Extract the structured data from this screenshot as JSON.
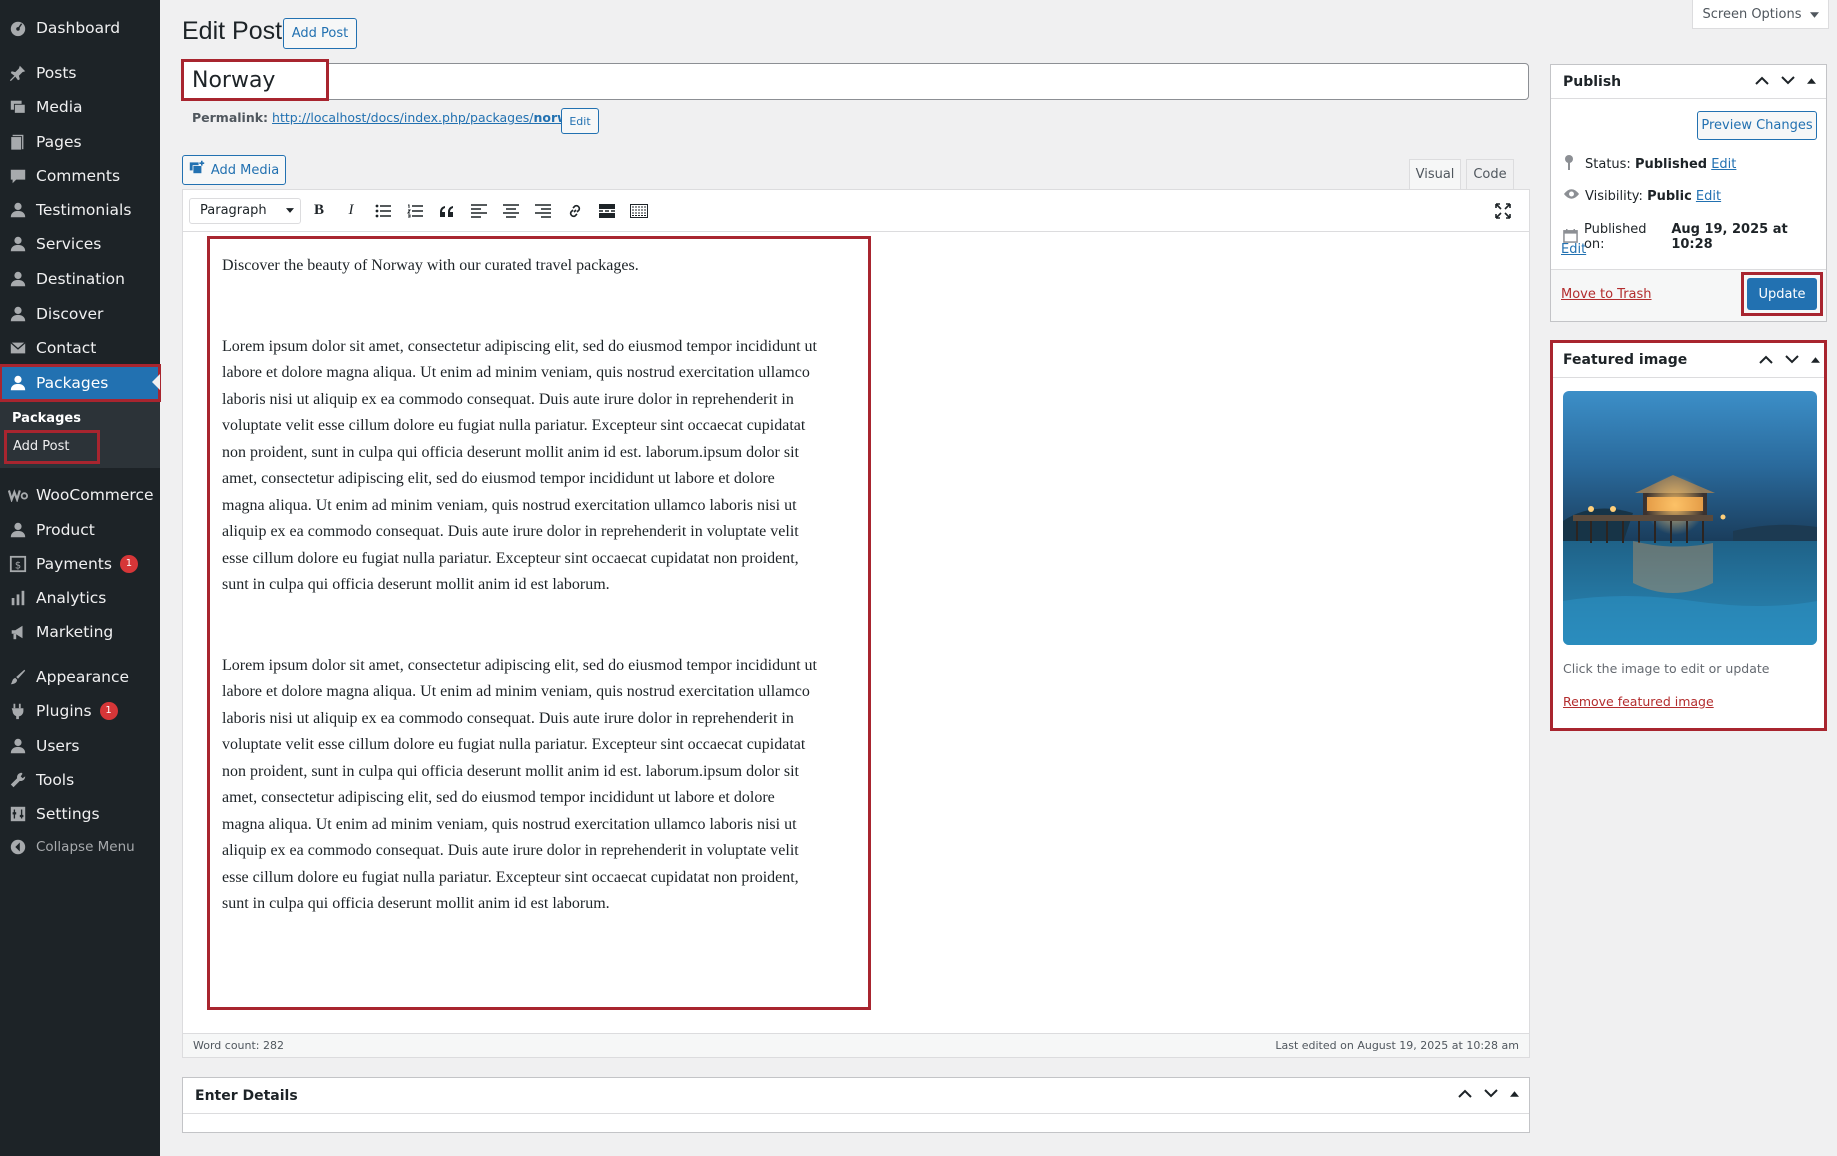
{
  "sidebar": {
    "items": [
      {
        "key": "dashboard",
        "label": "Dashboard",
        "icon": "dashboard-icon"
      },
      {
        "key": "posts",
        "label": "Posts",
        "icon": "pin-icon"
      },
      {
        "key": "media",
        "label": "Media",
        "icon": "media-icon"
      },
      {
        "key": "pages",
        "label": "Pages",
        "icon": "page-icon"
      },
      {
        "key": "comments",
        "label": "Comments",
        "icon": "comment-icon"
      },
      {
        "key": "testimonials",
        "label": "Testimonials",
        "icon": "user-icon"
      },
      {
        "key": "services",
        "label": "Services",
        "icon": "user-icon"
      },
      {
        "key": "destination",
        "label": "Destination",
        "icon": "user-icon"
      },
      {
        "key": "discover",
        "label": "Discover",
        "icon": "user-icon"
      },
      {
        "key": "contact",
        "label": "Contact",
        "icon": "mail-icon"
      },
      {
        "key": "packages",
        "label": "Packages",
        "icon": "user-icon"
      },
      {
        "key": "woocommerce",
        "label": "WooCommerce",
        "icon": "woo-icon"
      },
      {
        "key": "product",
        "label": "Product",
        "icon": "user-icon"
      },
      {
        "key": "payments",
        "label": "Payments",
        "icon": "dollar-icon",
        "badge": "1"
      },
      {
        "key": "analytics",
        "label": "Analytics",
        "icon": "chart-icon"
      },
      {
        "key": "marketing",
        "label": "Marketing",
        "icon": "megaphone-icon"
      },
      {
        "key": "appearance",
        "label": "Appearance",
        "icon": "brush-icon"
      },
      {
        "key": "plugins",
        "label": "Plugins",
        "icon": "plugin-icon",
        "badge": "1"
      },
      {
        "key": "users",
        "label": "Users",
        "icon": "user-icon"
      },
      {
        "key": "tools",
        "label": "Tools",
        "icon": "wrench-icon"
      },
      {
        "key": "settings",
        "label": "Settings",
        "icon": "settings-icon"
      }
    ],
    "submenu_title": "Packages",
    "submenu_item": "Add Post",
    "collapse_label": "Collapse Menu"
  },
  "header": {
    "title": "Edit Post",
    "add_post_button": "Add Post",
    "screen_options": "Screen Options"
  },
  "post": {
    "title": "Norway",
    "permalink_label": "Permalink:",
    "permalink_base": "http://localhost/docs/index.php/packages/",
    "permalink_slug": "norway",
    "permalink_end": "/",
    "permalink_edit": "Edit"
  },
  "editor": {
    "add_media": "Add Media",
    "tab_visual": "Visual",
    "tab_code": "Code",
    "format_select": "Paragraph",
    "paragraphs": [
      "Discover the beauty of Norway with our curated travel packages.",
      "Lorem ipsum dolor sit amet, consectetur adipiscing elit, sed do eiusmod tempor incididunt ut labore et dolore magna aliqua. Ut enim ad minim veniam, quis nostrud exercitation ullamco laboris nisi ut aliquip ex ea commodo consequat. Duis aute irure dolor in reprehenderit in voluptate velit esse cillum dolore eu fugiat nulla pariatur. Excepteur sint occaecat cupidatat non proident, sunt in culpa qui officia deserunt mollit anim id est. laborum.ipsum dolor sit amet, consectetur adipiscing elit, sed do eiusmod tempor incididunt ut labore et dolore magna aliqua. Ut enim ad minim veniam, quis nostrud exercitation ullamco laboris nisi ut aliquip ex ea commodo consequat. Duis aute irure dolor in reprehenderit in voluptate velit esse cillum dolore eu fugiat nulla pariatur. Excepteur sint occaecat cupidatat non proident, sunt in culpa qui officia deserunt mollit anim id est laborum.",
      "Lorem ipsum dolor sit amet, consectetur adipiscing elit, sed do eiusmod tempor incididunt ut labore et dolore magna aliqua. Ut enim ad minim veniam, quis nostrud exercitation ullamco laboris nisi ut aliquip ex ea commodo consequat. Duis aute irure dolor in reprehenderit in voluptate velit esse cillum dolore eu fugiat nulla pariatur. Excepteur sint occaecat cupidatat non proident, sunt in culpa qui officia deserunt mollit anim id est. laborum.ipsum dolor sit amet, consectetur adipiscing elit, sed do eiusmod tempor incididunt ut labore et dolore magna aliqua. Ut enim ad minim veniam, quis nostrud exercitation ullamco laboris nisi ut aliquip ex ea commodo consequat. Duis aute irure dolor in reprehenderit in voluptate velit esse cillum dolore eu fugiat nulla pariatur. Excepteur sint occaecat cupidatat non proident, sunt in culpa qui officia deserunt mollit anim id est laborum."
    ],
    "word_count": "Word count: 282",
    "last_edited": "Last edited on August 19, 2025 at 10:28 am"
  },
  "publish": {
    "title": "Publish",
    "preview_button": "Preview Changes",
    "status_label": "Status:",
    "status_value": "Published",
    "visibility_label": "Visibility:",
    "visibility_value": "Public",
    "published_label": "Published on:",
    "published_value": "Aug 19, 2025 at 10:28",
    "edit_link": "Edit",
    "trash_link": "Move to Trash",
    "update_button": "Update"
  },
  "featured": {
    "title": "Featured image",
    "hint": "Click the image to edit or update",
    "remove_link": "Remove featured image"
  },
  "details": {
    "title": "Enter Details"
  },
  "colors": {
    "accent": "#2271b1",
    "sidebar": "#1d2327",
    "highlight": "#a8252f",
    "badge": "#d63638",
    "trash": "#b32d2e"
  }
}
